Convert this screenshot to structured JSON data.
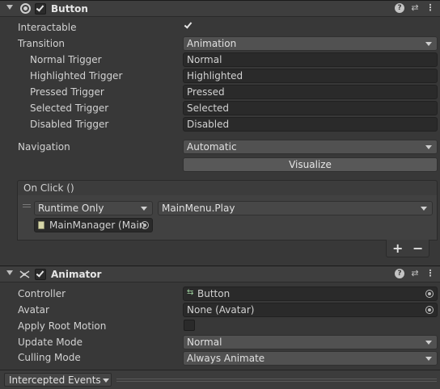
{
  "button_component": {
    "title": "Button",
    "interactable_label": "Interactable",
    "transition_label": "Transition",
    "transition_value": "Animation",
    "triggers": [
      {
        "label": "Normal Trigger",
        "value": "Normal"
      },
      {
        "label": "Highlighted Trigger",
        "value": "Highlighted"
      },
      {
        "label": "Pressed Trigger",
        "value": "Pressed"
      },
      {
        "label": "Selected Trigger",
        "value": "Selected"
      },
      {
        "label": "Disabled Trigger",
        "value": "Disabled"
      }
    ],
    "navigation_label": "Navigation",
    "navigation_value": "Automatic",
    "visualize_label": "Visualize",
    "on_click": {
      "header": "On Click ()",
      "runtime_value": "Runtime Only",
      "function_value": "MainMenu.Play",
      "object_value": "MainManager (Main",
      "add_label": "+",
      "remove_label": "−"
    }
  },
  "animator_component": {
    "title": "Animator",
    "controller_label": "Controller",
    "controller_value": "Button",
    "avatar_label": "Avatar",
    "avatar_value": "None (Avatar)",
    "apply_root_motion_label": "Apply Root Motion",
    "update_mode_label": "Update Mode",
    "update_mode_value": "Normal",
    "culling_mode_label": "Culling Mode",
    "culling_mode_value": "Always Animate"
  },
  "footer": {
    "intercepted_events_label": "Intercepted Events"
  }
}
